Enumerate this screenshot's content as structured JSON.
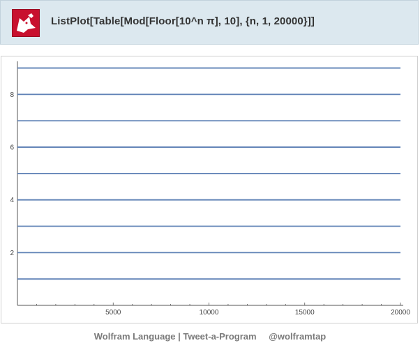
{
  "header": {
    "title": "ListPlot[Table[Mod[Floor[10^n π], 10], {n, 1, 20000}]]",
    "logo_icon": "wolfram-spikey-wolf-icon",
    "logo_color": "#c8102e",
    "background": "#dce8ef"
  },
  "footer": {
    "brand": "Wolfram Language | Tweet-a-Program",
    "handle": "@wolframtap"
  },
  "chart_data": {
    "type": "scatter",
    "title": "",
    "xlabel": "",
    "ylabel": "",
    "xlim": [
      0,
      20000
    ],
    "ylim": [
      0,
      9.2
    ],
    "x_ticks": [
      5000,
      10000,
      15000,
      20000
    ],
    "y_ticks": [
      2,
      4,
      6,
      8
    ],
    "series_color": "#5e81b5",
    "grid": false,
    "series": [
      {
        "description_of_values": "digits 1-9 plotted at each n from 1 to 20000, drawing horizontal bands",
        "bands": [
          1,
          2,
          3,
          4,
          5,
          6,
          7,
          8,
          9
        ],
        "x_range": [
          1,
          20000
        ]
      }
    ]
  }
}
